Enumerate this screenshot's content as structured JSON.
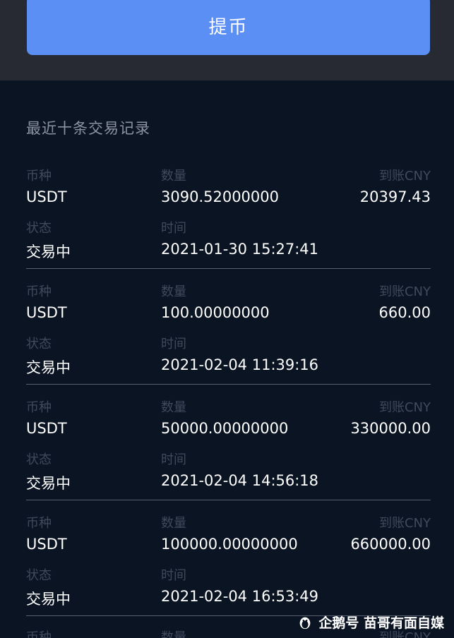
{
  "header": {
    "withdraw_label": "提币"
  },
  "section_title": "最近十条交易记录",
  "labels": {
    "currency": "币种",
    "amount": "数量",
    "received": "到账CNY",
    "status": "状态",
    "time": "时间"
  },
  "records": [
    {
      "currency": "USDT",
      "amount": "3090.52000000",
      "received": "20397.43",
      "status": "交易中",
      "time": "2021-01-30 15:27:41"
    },
    {
      "currency": "USDT",
      "amount": "100.00000000",
      "received": "660.00",
      "status": "交易中",
      "time": "2021-02-04 11:39:16"
    },
    {
      "currency": "USDT",
      "amount": "50000.00000000",
      "received": "330000.00",
      "status": "交易中",
      "time": "2021-02-04 14:56:18"
    },
    {
      "currency": "USDT",
      "amount": "100000.00000000",
      "received": "660000.00",
      "status": "交易中",
      "time": "2021-02-04 16:53:49"
    }
  ],
  "partial_record": {
    "currency_label": "币种",
    "amount_label": "数量",
    "received_label": "到账CNY"
  },
  "watermark": {
    "icon": "penguin-icon",
    "text": "企鹅号 苗哥有面自媒"
  },
  "colors": {
    "button": "#5b8ff4",
    "background": "#0b1422",
    "top_bar": "#272a33"
  }
}
